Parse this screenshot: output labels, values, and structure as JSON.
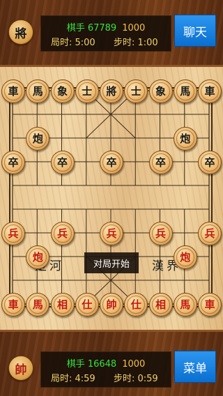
{
  "top_player": {
    "avatar_char": "將",
    "name": "棋手 67789",
    "score": "1000",
    "game_time_label": "局时: 5:00",
    "step_time_label": "步时: 1:00",
    "button_label": "聊天"
  },
  "bottom_player": {
    "avatar_char": "帥",
    "name": "棋手 16648",
    "score": "1000",
    "game_time_label": "局时: 4:59",
    "step_time_label": "步时: 0:59",
    "button_label": "菜单"
  },
  "board": {
    "river_left": "楚河",
    "river_right": "漢界",
    "status_message": "对局开始",
    "pieces": [
      {
        "char": "車",
        "side": "black",
        "col": 0,
        "row": 0
      },
      {
        "char": "馬",
        "side": "black",
        "col": 1,
        "row": 0
      },
      {
        "char": "象",
        "side": "black",
        "col": 2,
        "row": 0
      },
      {
        "char": "士",
        "side": "black",
        "col": 3,
        "row": 0
      },
      {
        "char": "將",
        "side": "black",
        "col": 4,
        "row": 0
      },
      {
        "char": "士",
        "side": "black",
        "col": 5,
        "row": 0
      },
      {
        "char": "象",
        "side": "black",
        "col": 6,
        "row": 0
      },
      {
        "char": "馬",
        "side": "black",
        "col": 7,
        "row": 0
      },
      {
        "char": "車",
        "side": "black",
        "col": 8,
        "row": 0
      },
      {
        "char": "炮",
        "side": "black",
        "col": 1,
        "row": 2
      },
      {
        "char": "炮",
        "side": "black",
        "col": 7,
        "row": 2
      },
      {
        "char": "卒",
        "side": "black",
        "col": 0,
        "row": 3
      },
      {
        "char": "卒",
        "side": "black",
        "col": 2,
        "row": 3
      },
      {
        "char": "卒",
        "side": "black",
        "col": 4,
        "row": 3
      },
      {
        "char": "卒",
        "side": "black",
        "col": 6,
        "row": 3
      },
      {
        "char": "卒",
        "side": "black",
        "col": 8,
        "row": 3
      },
      {
        "char": "兵",
        "side": "red",
        "col": 0,
        "row": 6
      },
      {
        "char": "兵",
        "side": "red",
        "col": 2,
        "row": 6
      },
      {
        "char": "兵",
        "side": "red",
        "col": 4,
        "row": 6
      },
      {
        "char": "兵",
        "side": "red",
        "col": 6,
        "row": 6
      },
      {
        "char": "兵",
        "side": "red",
        "col": 8,
        "row": 6
      },
      {
        "char": "炮",
        "side": "red",
        "col": 1,
        "row": 7
      },
      {
        "char": "炮",
        "side": "red",
        "col": 7,
        "row": 7
      },
      {
        "char": "車",
        "side": "red",
        "col": 0,
        "row": 9
      },
      {
        "char": "馬",
        "side": "red",
        "col": 1,
        "row": 9
      },
      {
        "char": "相",
        "side": "red",
        "col": 2,
        "row": 9
      },
      {
        "char": "仕",
        "side": "red",
        "col": 3,
        "row": 9
      },
      {
        "char": "帥",
        "side": "red",
        "col": 4,
        "row": 9
      },
      {
        "char": "仕",
        "side": "red",
        "col": 5,
        "row": 9
      },
      {
        "char": "相",
        "side": "red",
        "col": 6,
        "row": 9
      },
      {
        "char": "馬",
        "side": "red",
        "col": 7,
        "row": 9
      },
      {
        "char": "車",
        "side": "red",
        "col": 8,
        "row": 9
      }
    ]
  }
}
